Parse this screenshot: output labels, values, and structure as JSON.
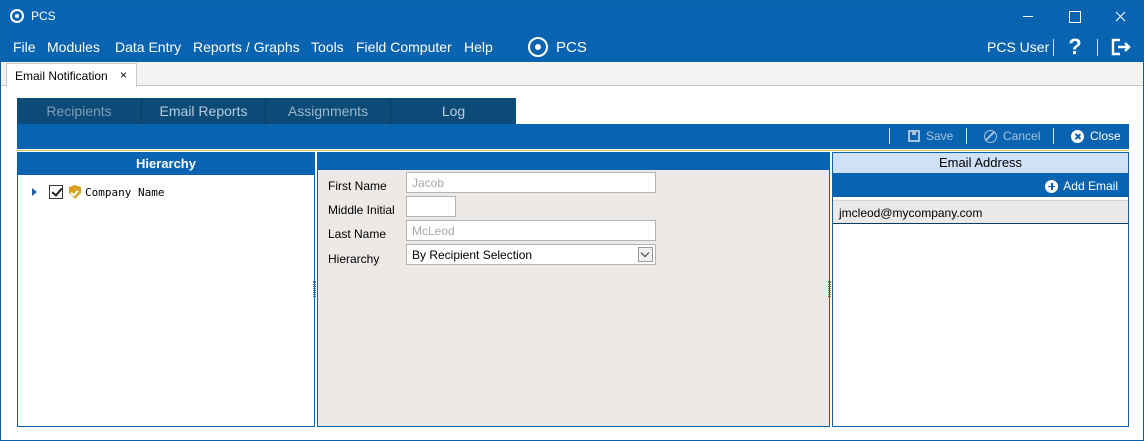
{
  "window": {
    "title": "PCS"
  },
  "menu": {
    "items": [
      "File",
      "Modules",
      "Data Entry",
      "Reports / Graphs",
      "Tools",
      "Field Computer",
      "Help"
    ],
    "brand": "PCS",
    "user": "PCS User",
    "help_glyph": "?"
  },
  "document_tab": {
    "label": "Email Notification",
    "close_glyph": "×"
  },
  "inner_tabs": [
    "Recipients",
    "Email Reports",
    "Assignments",
    "Log"
  ],
  "actions": {
    "save": "Save",
    "cancel": "Cancel",
    "close": "Close"
  },
  "hierarchy_panel": {
    "title": "Hierarchy",
    "tree": [
      {
        "label": "Company Name",
        "checked": true,
        "icon": "shield-icon"
      }
    ]
  },
  "form": {
    "first_name_label": "First Name",
    "first_name_value": "Jacob",
    "middle_initial_label": "Middle Initial",
    "middle_initial_value": "",
    "last_name_label": "Last Name",
    "last_name_value": "McLeod",
    "hierarchy_label": "Hierarchy",
    "hierarchy_value": "By Recipient Selection"
  },
  "email_panel": {
    "title": "Email Address",
    "add_label": "Add Email",
    "emails": [
      "jmcleod@mycompany.com"
    ]
  },
  "colors": {
    "primary": "#0863b0",
    "tab_dark": "#0c4a78",
    "header_light": "#cfe1f6",
    "form_bg": "#ece9e7"
  }
}
